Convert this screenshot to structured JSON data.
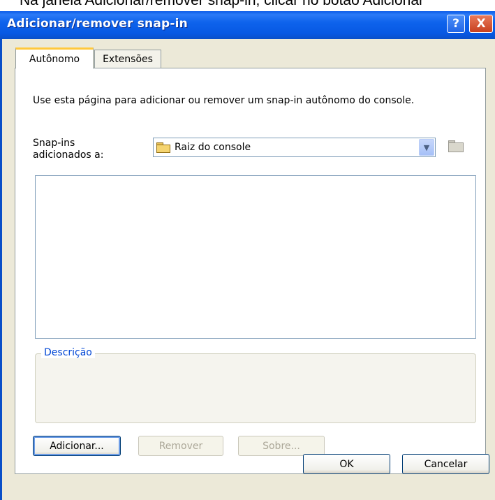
{
  "caption": "Na janela Adicionar/remover snap-in, clicar no botão Adicionar",
  "window": {
    "title": "Adicionar/remover snap-in",
    "help_symbol": "?",
    "close_symbol": "X"
  },
  "tabs": [
    {
      "label": "Autônomo",
      "active": true
    },
    {
      "label": "Extensões",
      "active": false
    }
  ],
  "intro_text": "Use esta página para adicionar ou remover um snap-in autônomo do console.",
  "snapins_label": "Snap-ins adicionados a:",
  "combo": {
    "value": "Raiz do console",
    "icon": "folder-icon"
  },
  "description_label": "Descrição",
  "buttons": {
    "add": "Adicionar...",
    "remove": "Remover",
    "about": "Sobre...",
    "ok": "OK",
    "cancel": "Cancelar"
  }
}
